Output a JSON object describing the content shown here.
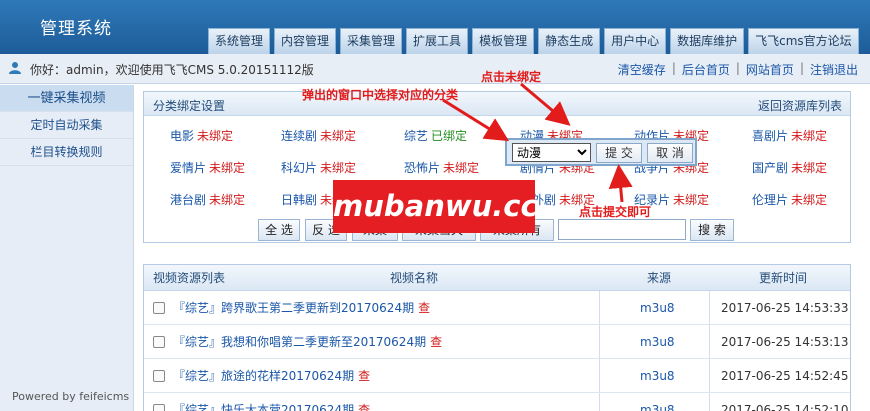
{
  "app": {
    "title": "管理系统"
  },
  "top_nav": [
    "系统管理",
    "内容管理",
    "采集管理",
    "扩展工具",
    "模板管理",
    "静态生成",
    "用户中心",
    "数据库维护",
    "飞飞cms官方论坛"
  ],
  "user_bar": {
    "welcome": "你好：admin，欢迎使用飞飞CMS 5.0.20151112版",
    "links": [
      "清空缓存",
      "后台首页",
      "网站首页",
      "注销退出"
    ]
  },
  "sidebar": {
    "items": [
      "一键采集视频",
      "定时自动采集",
      "栏目转换规则"
    ],
    "active_index": 0,
    "powered": "Powered by feifeicms"
  },
  "panel": {
    "title": "分类绑定设置",
    "back_link": "返回资源库列表",
    "rows": [
      [
        {
          "name": "电影",
          "status": "未绑定"
        },
        {
          "name": "连续剧",
          "status": "未绑定"
        },
        {
          "name": "综艺",
          "status": "已绑定"
        },
        {
          "name": "动漫",
          "status": "未绑定"
        },
        {
          "name": "动作片",
          "status": "未绑定"
        },
        {
          "name": "喜剧片",
          "status": "未绑定"
        }
      ],
      [
        {
          "name": "爱情片",
          "status": "未绑定"
        },
        {
          "name": "科幻片",
          "status": "未绑定"
        },
        {
          "name": "恐怖片",
          "status": "未绑定"
        },
        {
          "name": "剧情片",
          "status": "未绑定"
        },
        {
          "name": "战争片",
          "status": "未绑定"
        },
        {
          "name": "国产剧",
          "status": "未绑定"
        }
      ],
      [
        {
          "name": "港台剧",
          "status": "未绑定"
        },
        {
          "name": "日韩剧",
          "status": "未绑定"
        },
        {
          "name": "欧美剧",
          "status": "未绑定"
        },
        {
          "name": "海外剧",
          "status": "未绑定"
        },
        {
          "name": "纪录片",
          "status": "未绑定"
        },
        {
          "name": "伦理片",
          "status": "未绑定"
        }
      ]
    ],
    "buttons": [
      "全 选",
      "反 选",
      "采集",
      "采集当天",
      "采集所有"
    ],
    "search_button": "搜 索",
    "search_value": ""
  },
  "popup": {
    "selected": "动漫",
    "submit": "提 交",
    "cancel": "取 消"
  },
  "watermark": "mubanwu.cc",
  "annotations": {
    "click_unbound": "点击未绑定",
    "select_category": "弹出的窗口中选择对应的分类",
    "click_submit": "点击提交即可"
  },
  "table": {
    "headers": [
      "视频资源列表",
      "视频名称",
      "来源",
      "更新时间"
    ],
    "rows": [
      {
        "title": "『综艺』跨界歌王第二季更新到20170624期",
        "action": "查",
        "source": "m3u8",
        "time": "2017-06-25 14:53:33"
      },
      {
        "title": "『综艺』我想和你唱第二季更新至20170624期",
        "action": "查",
        "source": "m3u8",
        "time": "2017-06-25 14:53:13"
      },
      {
        "title": "『综艺』旅途的花样20170624期",
        "action": "查",
        "source": "m3u8",
        "time": "2017-06-25 14:52:45"
      },
      {
        "title": "『综艺』快乐大本营20170624期",
        "action": "查",
        "source": "m3u8",
        "time": "2017-06-25 14:52:10"
      }
    ]
  },
  "colors": {
    "header_blue": "#1d5c98",
    "unbound_red": "#d21c1c",
    "bound_green": "#23901f",
    "link_blue": "#1a57a8",
    "annotation_red": "#e21b1b"
  }
}
